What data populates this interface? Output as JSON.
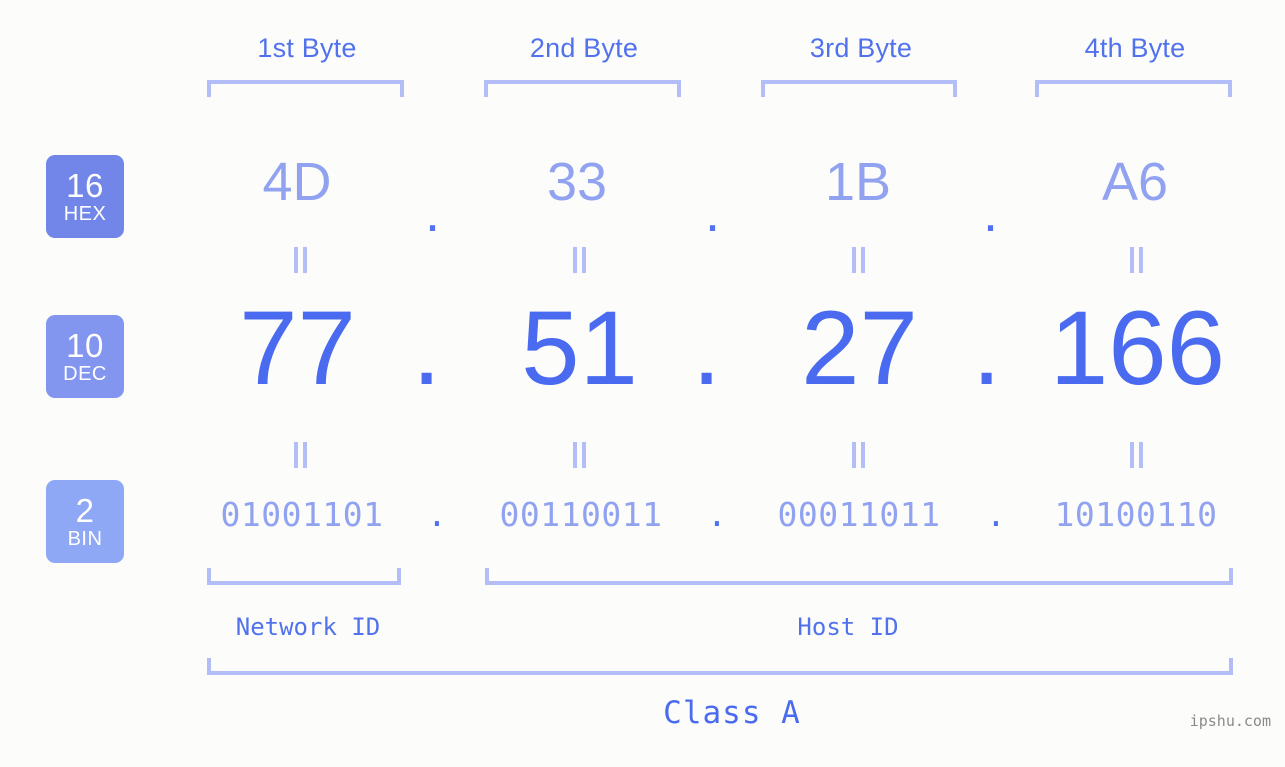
{
  "background_color": "#fcfdfa",
  "accent_colors": {
    "strong_blue": "#4a6af0",
    "mid_blue": "#5272ed",
    "light_blue": "#91a3f0",
    "bracket_blue": "#b3bdf7",
    "badge_hex": "#7186e8",
    "badge_dec": "#8296f0",
    "badge_bin": "#8fa8f6",
    "watermark_gray": "#8a8a8a"
  },
  "byte_headers": [
    {
      "label": "1st Byte"
    },
    {
      "label": "2nd Byte"
    },
    {
      "label": "3rd Byte"
    },
    {
      "label": "4th Byte"
    }
  ],
  "bases": [
    {
      "number": "16",
      "abbr": "HEX"
    },
    {
      "number": "10",
      "abbr": "DEC"
    },
    {
      "number": "2",
      "abbr": "BIN"
    }
  ],
  "rows": {
    "hex": {
      "values": [
        "4D",
        "33",
        "1B",
        "A6"
      ],
      "separator": "."
    },
    "dec": {
      "values": [
        "77",
        "51",
        "27",
        "166"
      ],
      "separator": "."
    },
    "bin": {
      "values": [
        "01001101",
        "00110011",
        "00011011",
        "10100110"
      ],
      "separator": "."
    }
  },
  "equals_marks": {
    "symbol": "||",
    "count_per_row": 4
  },
  "segments": {
    "network_id": {
      "label": "Network ID"
    },
    "host_id": {
      "label": "Host ID"
    }
  },
  "class": {
    "label": "Class A"
  },
  "watermark": {
    "text": "ipshu.com"
  }
}
